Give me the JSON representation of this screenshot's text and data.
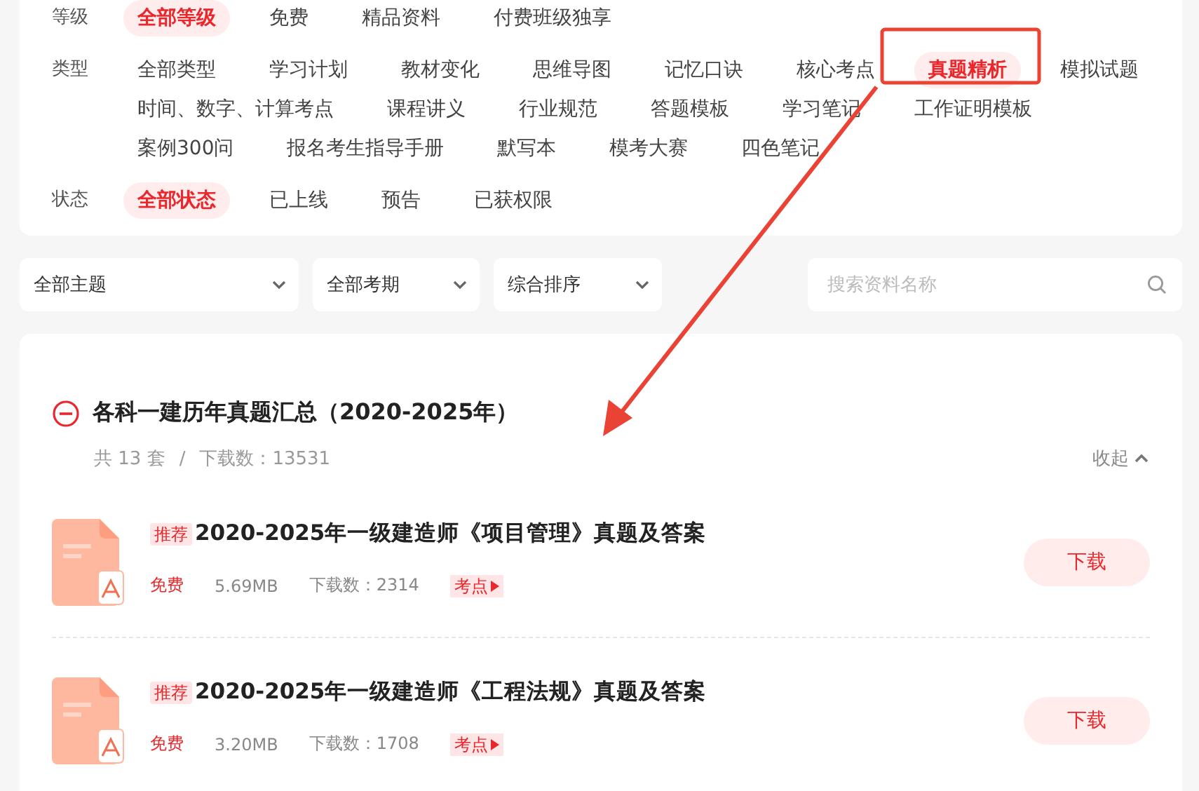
{
  "filters": [
    {
      "label": "等级",
      "options": [
        {
          "text": "全部等级",
          "selected": true
        },
        {
          "text": "免费",
          "selected": false
        },
        {
          "text": "精品资料",
          "selected": false
        },
        {
          "text": "付费班级独享",
          "selected": false
        }
      ]
    },
    {
      "label": "类型",
      "options": [
        {
          "text": "全部类型",
          "selected": false
        },
        {
          "text": "学习计划",
          "selected": false
        },
        {
          "text": "教材变化",
          "selected": false
        },
        {
          "text": "思维导图",
          "selected": false
        },
        {
          "text": "记忆口诀",
          "selected": false
        },
        {
          "text": "核心考点",
          "selected": false
        },
        {
          "text": "真题精析",
          "selected": true
        },
        {
          "text": "模拟试题",
          "selected": false
        },
        {
          "text": "时间、数字、计算考点",
          "selected": false
        },
        {
          "text": "课程讲义",
          "selected": false
        },
        {
          "text": "行业规范",
          "selected": false
        },
        {
          "text": "答题模板",
          "selected": false
        },
        {
          "text": "学习笔记",
          "selected": false
        },
        {
          "text": "工作证明模板",
          "selected": false
        },
        {
          "text": "案例300问",
          "selected": false
        },
        {
          "text": "报名考生指导手册",
          "selected": false
        },
        {
          "text": "默写本",
          "selected": false
        },
        {
          "text": "模考大赛",
          "selected": false
        },
        {
          "text": "四色笔记",
          "selected": false
        }
      ]
    },
    {
      "label": "状态",
      "options": [
        {
          "text": "全部状态",
          "selected": true
        },
        {
          "text": "已上线",
          "selected": false
        },
        {
          "text": "预告",
          "selected": false
        },
        {
          "text": "已获权限",
          "selected": false
        }
      ]
    }
  ],
  "dropdowns": [
    {
      "value": "全部主题"
    },
    {
      "value": "全部考期"
    },
    {
      "value": "综合排序"
    }
  ],
  "search": {
    "placeholder": "搜索资料名称"
  },
  "group": {
    "title": "各科一建历年真题汇总（2020-2025年）",
    "count": "共 13 套",
    "separator": "/",
    "downloads": "下载数：13531",
    "collapse": "收起",
    "expanded": true
  },
  "files": [
    {
      "tag": "推荐",
      "title": "2020-2025年一级建造师《项目管理》真题及答案",
      "price": "免费",
      "size": "5.69MB",
      "downloads": "下载数：2314",
      "badge": "考点",
      "button": "下载"
    },
    {
      "tag": "推荐",
      "title": "2020-2025年一级建造师《工程法规》真题及答案",
      "price": "免费",
      "size": "3.20MB",
      "downloads": "下载数：1708",
      "badge": "考点",
      "button": "下载"
    }
  ]
}
